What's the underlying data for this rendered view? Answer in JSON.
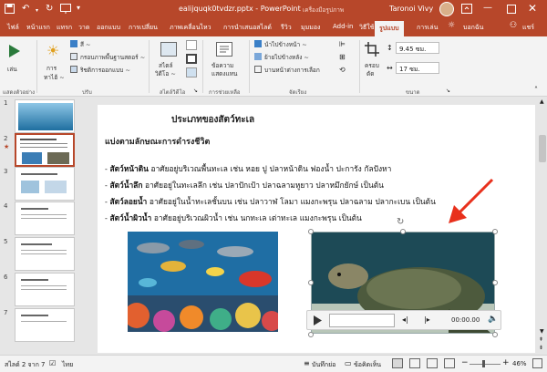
{
  "titlebar": {
    "filename": "ealijquqk0tvdzr.pptx",
    "app": "PowerPoint",
    "picture_tools": "เครื่องมือรูปภาพ",
    "user": "Taronoi Vivy"
  },
  "tabs": [
    "ไฟล์",
    "หน้าแรก",
    "แทรก",
    "วาด",
    "ออกแบบ",
    "การเปลี่ยน",
    "ภาพเคลื่อนไหว",
    "การนำเสนอสไลด์",
    "รีวิว",
    "มุมมอง",
    "Add-in",
    "วิธีใช้",
    "รูปแบบ",
    "การเล่น"
  ],
  "tell_me": "บอกฉัน",
  "share": "แชร์",
  "ribbon": {
    "play": "เล่น",
    "add_bookmark": "การ",
    "add_bookmark2": "ทาไฮ้ ~",
    "fill": "สี ~",
    "border": "กรอบภาพพื้นฐานสตอร์ ~",
    "effects": "ริชติการออกแบบ ~",
    "styles": "สไตล์",
    "styles2": "วิดีโอ ~",
    "alt_text": "ข้อความ",
    "alt_text2": "แสดงแทน",
    "bring_forward": "นำไปข้างหน้า ~",
    "send_backward": "ย้ายไปข้างหลัง ~",
    "selection_pane": "บานหน้าต่างการเลือก",
    "crop": "ครอบ",
    "crop2": "ตัด",
    "height": "9.45 ซม.",
    "width": "17 ซม.",
    "group_preview": "แสดงตัวอย่าง",
    "group_adjust": "ปรับ",
    "group_styles": "สไตล์วิดีโอ",
    "group_access": "การช่วยเหลือ",
    "group_arrange": "จัดเรียง",
    "group_size": "ขนาด"
  },
  "thumbs": [
    "1",
    "2",
    "3",
    "4",
    "5",
    "6",
    "7"
  ],
  "slide": {
    "title": "ประเภทของสัตว์ทะเล",
    "subtitle": "แบ่งตามลักษณะการดำรงชีวิต",
    "b1_bold": "สัตว์หน้าดิน",
    "b1": " อาศัยอยู่บริเวณพื้นทะเล เช่น หอย ปู ปลาหน้าดิน ฟองน้ำ ปะการัง กัลปังหา",
    "b2_bold": "สัตว์น้ำลึก",
    "b2": " อาศัยอยู่ในทะเลลึก เช่น ปลาปักเป้า ปลาฉลามหูยาว ปลาหมึกยักษ์ เป็นต้น",
    "b3_bold": "สัตว์ลอยน้ำ",
    "b3": " อาศัยอยู่ในน้ำทะเลชั้นบน เช่น ปลาวาฬ โลมา แมงกะพรุน ปลาฉลาม ปลากะเบน เป็นต้น",
    "b4_bold": "สัตว์น้ำผิวน้ำ",
    "b4": " อาศัยอยู่บริเวณผิวน้ำ เช่น นกทะเล เต่าทะเล แมงกะพรุน เป็นต้น",
    "video_time": "00:00.00"
  },
  "status": {
    "slide": "สไลด์ 2 จาก 7",
    "lang": "ไทย",
    "notes": "บันทึกย่อ",
    "comments": "ข้อคิดเห็น",
    "zoom": "46%"
  },
  "colors": {
    "accent": "#b7472a",
    "arrow": "#e8301c"
  }
}
